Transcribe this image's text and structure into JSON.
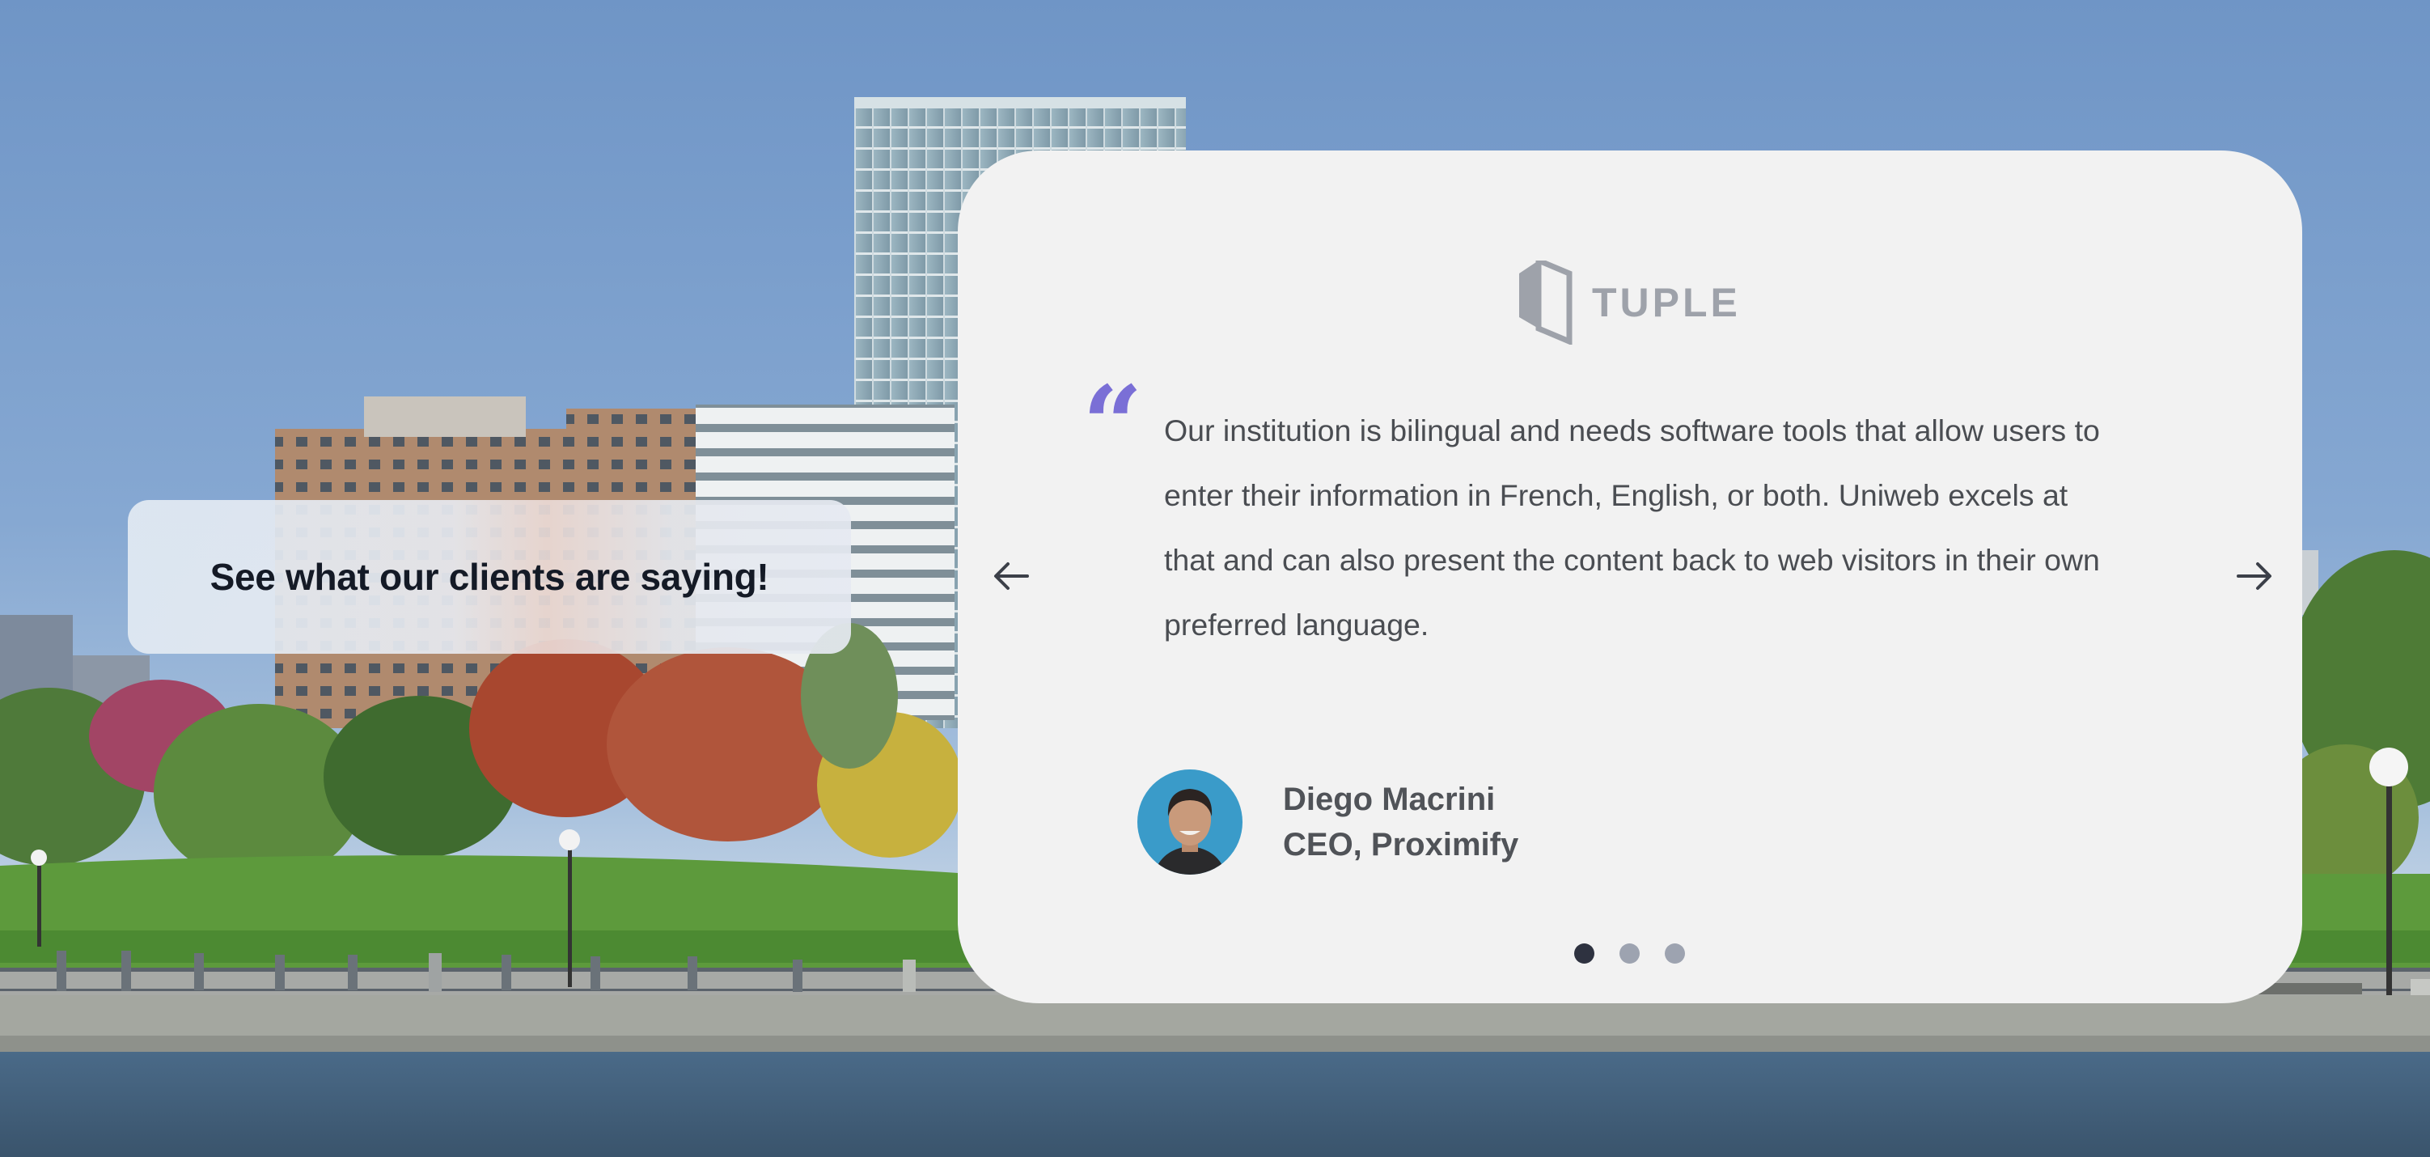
{
  "heading": "See what our clients are saying!",
  "testimonial": {
    "logo_text": "TUPLE",
    "quote_mark": "“",
    "quote": "Our institution is bilingual and needs software tools that allow users to enter their information in French, English, or both. Uniweb excels at that and can also present the content back to web visitors in their own preferred language.",
    "author_name": "Diego Macrini",
    "author_title": "CEO, Proximify"
  },
  "carousel": {
    "prev_icon": "arrow-left-icon",
    "next_icon": "arrow-right-icon",
    "slides": 3,
    "active_index": 0
  },
  "colors": {
    "card_background": "#f2f2f2",
    "quote_accent": "#7a6fd6",
    "active_dot": "#2e3240",
    "inactive_dot": "#9da3b0"
  }
}
